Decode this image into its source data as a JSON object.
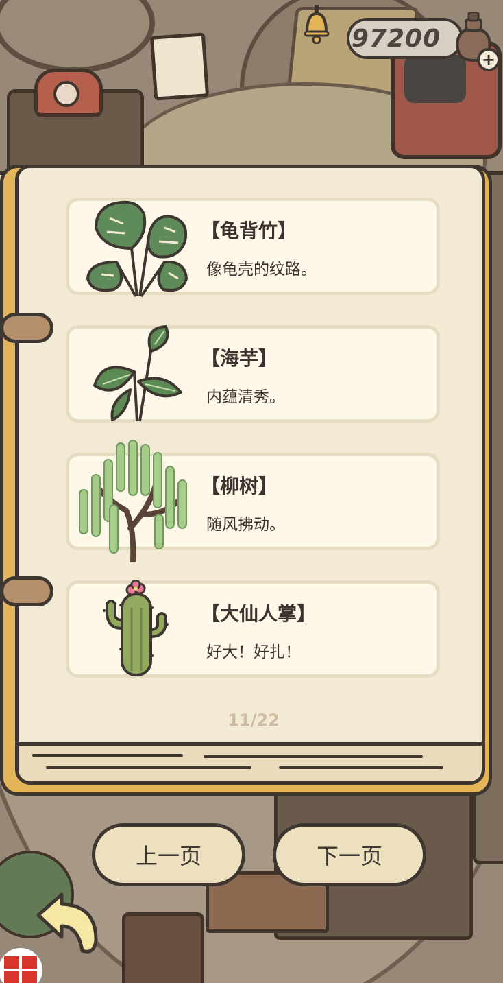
{
  "header": {
    "coins": "97200",
    "coin_bag_icon": "coin-bag-icon",
    "add_coins_icon": "plus-icon"
  },
  "book": {
    "items": [
      {
        "name": "【龟背竹】",
        "description": "像龟壳的纹路。",
        "icon": "monstera-plant-icon"
      },
      {
        "name": "【海芋】",
        "description": "内蕴清秀。",
        "icon": "alocasia-plant-icon"
      },
      {
        "name": "【柳树】",
        "description": "随风拂动。",
        "icon": "willow-tree-icon"
      },
      {
        "name": "【大仙人掌】",
        "description": "好大！好扎！",
        "icon": "big-cactus-icon"
      }
    ],
    "page_indicator": "11/22"
  },
  "navigation": {
    "prev_label": "上一页",
    "next_label": "下一页",
    "back_icon": "back-arrow-icon"
  },
  "colors": {
    "page_bg": "#f2ead4",
    "card_bg": "#fdf8e7",
    "card_border": "#e6dcc1",
    "outline": "#3e3731",
    "book_spine": "#e3b458",
    "button_bg": "#ece0bf",
    "page_indicator": "#cdbaa1"
  }
}
